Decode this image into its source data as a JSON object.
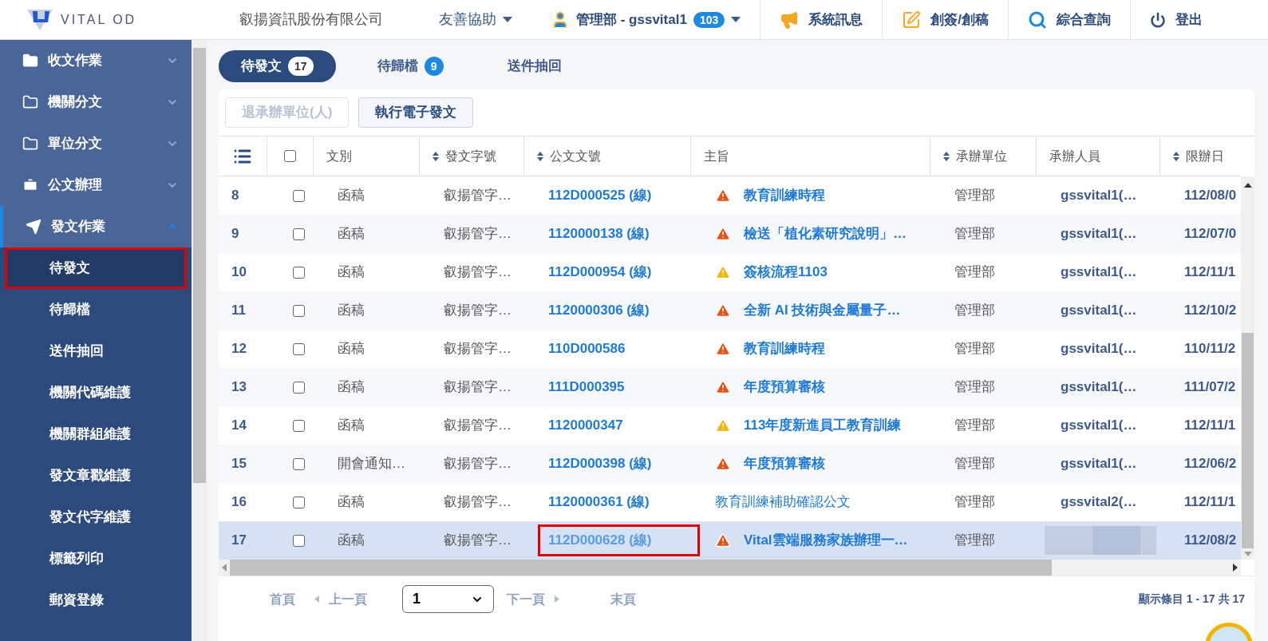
{
  "header": {
    "logo_text": "VITAL OD",
    "company": "叡揚資訊股份有限公司",
    "help_menu": "友善協助",
    "user": "管理部 - gssvital1",
    "user_badge": "103",
    "actions": [
      {
        "kind": "megaphone",
        "label": "系統訊息"
      },
      {
        "kind": "edit",
        "label": "創簽/創稿"
      },
      {
        "kind": "search",
        "label": "綜合查詢"
      },
      {
        "kind": "power",
        "label": "登出"
      }
    ]
  },
  "sidebar": {
    "items": [
      {
        "kind": "folder-filled",
        "label": "收文作業",
        "expanded": false,
        "active": false
      },
      {
        "kind": "folder",
        "label": "機關分文",
        "expanded": false,
        "active": false
      },
      {
        "kind": "folder",
        "label": "單位分文",
        "expanded": false,
        "active": false
      },
      {
        "kind": "briefcase",
        "label": "公文辦理",
        "expanded": false,
        "active": false
      },
      {
        "kind": "plane",
        "label": "發文作業",
        "expanded": true,
        "active": true,
        "children": [
          {
            "label": "待發文",
            "selected": true,
            "highlighted": true
          },
          {
            "label": "待歸檔",
            "selected": false,
            "highlighted": false
          },
          {
            "label": "送件抽回",
            "selected": false,
            "highlighted": false
          },
          {
            "label": "機關代碼維護",
            "selected": false,
            "highlighted": false
          },
          {
            "label": "機關群組維護",
            "selected": false,
            "highlighted": false
          },
          {
            "label": "發文章戳維護",
            "selected": false,
            "highlighted": false
          },
          {
            "label": "發文代字維護",
            "selected": false,
            "highlighted": false
          },
          {
            "label": "標籤列印",
            "selected": false,
            "highlighted": false
          },
          {
            "label": "郵資登錄",
            "selected": false,
            "highlighted": false
          }
        ]
      }
    ]
  },
  "tabs": [
    {
      "label": "待發文",
      "count": "17",
      "selected": true
    },
    {
      "label": "待歸檔",
      "count": "9",
      "selected": false
    },
    {
      "label": "送件抽回",
      "selected": false
    }
  ],
  "toolbar": [
    {
      "label": "退承辦單位(人)",
      "disabled": true
    },
    {
      "label": "執行電子發文",
      "disabled": false
    }
  ],
  "table": {
    "all_checked": false,
    "columns": [
      {
        "label": "文別",
        "sortable": false
      },
      {
        "label": "發文字號",
        "sortable": true
      },
      {
        "label": "公文文號",
        "sortable": true
      },
      {
        "label": "主旨",
        "sortable": false
      },
      {
        "label": "承辦單位",
        "sortable": true
      },
      {
        "label": "承辦人員",
        "sortable": false
      },
      {
        "label": "限辦日",
        "sortable": true
      }
    ],
    "rows": [
      {
        "no": "8",
        "checked": false,
        "selected": false,
        "type": "函稿",
        "issue_no": "叡揚管字…",
        "doc_no": "112D000525 (線)",
        "doc_highlighted": false,
        "kind": "urgent",
        "subject": "教育訓練時程",
        "unit": "管理部",
        "handler": "gssvital1(…",
        "handler_blurred": false,
        "due": "112/08/0"
      },
      {
        "no": "9",
        "checked": false,
        "selected": false,
        "type": "函稿",
        "issue_no": "叡揚管字…",
        "doc_no": "1120000138 (線)",
        "doc_highlighted": false,
        "kind": "urgent",
        "subject": "檢送「植化素研究說明」…",
        "unit": "管理部",
        "handler": "gssvital1(…",
        "handler_blurred": false,
        "due": "112/07/0"
      },
      {
        "no": "10",
        "checked": false,
        "selected": false,
        "type": "函稿",
        "issue_no": "叡揚管字…",
        "doc_no": "112D000954 (線)",
        "doc_highlighted": false,
        "kind": "warning",
        "subject": "簽核流程1103",
        "unit": "管理部",
        "handler": "gssvital1(…",
        "handler_blurred": false,
        "due": "112/11/1"
      },
      {
        "no": "11",
        "checked": false,
        "selected": false,
        "type": "函稿",
        "issue_no": "叡揚管字…",
        "doc_no": "1120000306 (線)",
        "doc_highlighted": false,
        "kind": "urgent",
        "subject": "全新 AI 技術與金屬量子…",
        "unit": "管理部",
        "handler": "gssvital1(…",
        "handler_blurred": false,
        "due": "112/10/2"
      },
      {
        "no": "12",
        "checked": false,
        "selected": false,
        "type": "函稿",
        "issue_no": "叡揚管字…",
        "doc_no": "110D000586",
        "doc_highlighted": false,
        "kind": "urgent",
        "subject": "教育訓練時程",
        "unit": "管理部",
        "handler": "gssvital1(…",
        "handler_blurred": false,
        "due": "110/11/2"
      },
      {
        "no": "13",
        "checked": false,
        "selected": false,
        "type": "函稿",
        "issue_no": "叡揚管字…",
        "doc_no": "111D000395",
        "doc_highlighted": false,
        "kind": "urgent",
        "subject": "年度預算審核",
        "unit": "管理部",
        "handler": "gssvital1(…",
        "handler_blurred": false,
        "due": "111/07/2"
      },
      {
        "no": "14",
        "checked": false,
        "selected": false,
        "type": "函稿",
        "issue_no": "叡揚管字…",
        "doc_no": "1120000347",
        "doc_highlighted": false,
        "kind": "warning",
        "subject": "113年度新進員工教育訓練",
        "unit": "管理部",
        "handler": "gssvital1(…",
        "handler_blurred": false,
        "due": "112/11/1"
      },
      {
        "no": "15",
        "checked": false,
        "selected": false,
        "type": "開會通知…",
        "issue_no": "叡揚管字…",
        "doc_no": "112D000398 (線)",
        "doc_highlighted": false,
        "kind": "urgent",
        "subject": "年度預算審核",
        "unit": "管理部",
        "handler": "gssvital1(…",
        "handler_blurred": false,
        "due": "112/06/2"
      },
      {
        "no": "16",
        "checked": false,
        "selected": false,
        "type": "函稿",
        "issue_no": "叡揚管字…",
        "doc_no": "1120000361 (線)",
        "doc_highlighted": false,
        "kind": "plain",
        "subject": "教育訓練補助確認公文",
        "unit": "管理部",
        "handler": "gssvital2(…",
        "handler_blurred": false,
        "due": "112/11/1"
      },
      {
        "no": "17",
        "checked": false,
        "selected": true,
        "type": "函稿",
        "issue_no": "叡揚管字…",
        "doc_no": "112D000628 (線)",
        "doc_highlighted": true,
        "kind": "urgent",
        "subject": "Vital雲端服務家族辦理一…",
        "unit": "管理部",
        "handler_blurred": true,
        "due": "112/08/2"
      }
    ]
  },
  "pagination": {
    "first": "首頁",
    "prev": "上一頁",
    "page": "1",
    "next": "下一頁",
    "last": "末頁",
    "summary": "顯示條目 1 - 17 共 17"
  }
}
